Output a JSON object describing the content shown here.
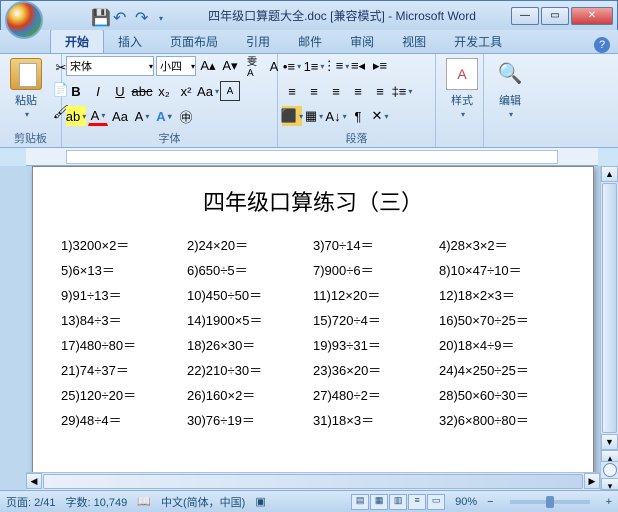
{
  "window": {
    "doc_name": "四年级口算题大全.doc",
    "compat": "[兼容模式]",
    "app": "Microsoft Word",
    "title_full": "四年级口算题大全.doc [兼容模式] - Microsoft Word"
  },
  "tabs": {
    "home": "开始",
    "insert": "插入",
    "layout": "页面布局",
    "references": "引用",
    "mailings": "邮件",
    "review": "审阅",
    "view": "视图",
    "developer": "开发工具"
  },
  "ribbon": {
    "clipboard": {
      "label": "剪贴板",
      "paste": "粘贴"
    },
    "font": {
      "label": "字体",
      "name": "宋体",
      "size": "小四"
    },
    "paragraph": {
      "label": "段落"
    },
    "styles": {
      "label": "样式"
    },
    "editing": {
      "label": "编辑"
    }
  },
  "document": {
    "title": "四年级口算练习（三）",
    "problems": [
      "1)3200×2＝",
      "2)24×20＝",
      "3)70÷14＝",
      "4)28×3×2＝",
      "5)6×13＝",
      "6)650÷5＝",
      "7)900÷6＝",
      "8)10×47÷10＝",
      "9)91÷13＝",
      "10)450÷50＝",
      "11)12×20＝",
      "12)18×2×3＝",
      "13)84÷3＝",
      "14)1900×5＝",
      "15)720÷4＝",
      "16)50×70÷25＝",
      "17)480÷80＝",
      "18)26×30＝",
      "19)93÷31＝",
      "20)18×4÷9＝",
      "21)74÷37＝",
      "22)210÷30＝",
      "23)36×20＝",
      "24)4×250÷25＝",
      "25)120÷20＝",
      "26)160×2＝",
      "27)480÷2＝",
      "28)50×60÷30＝",
      "29)48÷4＝",
      "30)76÷19＝",
      "31)18×3＝",
      "32)6×800÷80＝"
    ]
  },
  "status": {
    "page": "页面: 2/41",
    "words": "字数: 10,749",
    "lang": "中文(简体，中国)",
    "zoom": "90%"
  }
}
